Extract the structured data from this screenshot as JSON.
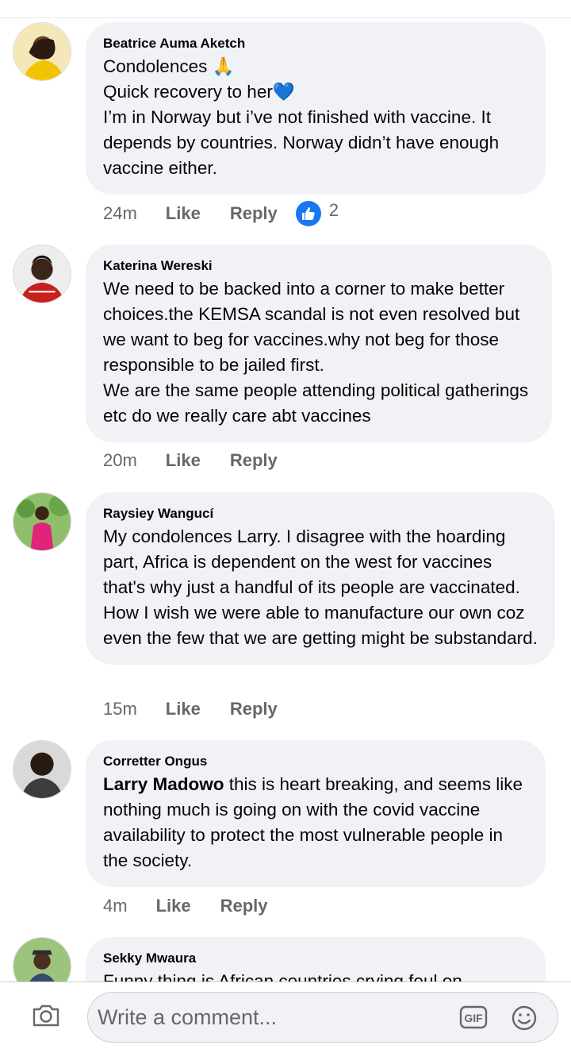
{
  "comments": [
    {
      "author": "Beatrice Auma Aketch",
      "text": "Condolences 🙏\nQuick recovery to her💙\nI’m in Norway but i’ve not finished with vaccine. It depends by countries. Norway didn’t have enough vaccine either.",
      "time": "24m",
      "like_label": "Like",
      "reply_label": "Reply",
      "reaction_count": "2"
    },
    {
      "author": "Katerina Wereski",
      "text": "We need to be backed into a corner to make better choices.the KEMSA scandal is not even resolved but we want to beg for vaccines.why not beg for those responsible to be jailed first.\nWe are the same people attending political gatherings etc do we really care abt vaccines",
      "time": "20m",
      "like_label": "Like",
      "reply_label": "Reply"
    },
    {
      "author": "Raysiey Wangucí",
      "text": "My condolences Larry. I disagree with the hoarding part, Africa is dependent on the west for vaccines that's why just a handful of its people are vaccinated. How I wish we were able to manufacture our own coz even the few that we are getting might be substandard.",
      "time": "15m",
      "like_label": "Like",
      "reply_label": "Reply"
    },
    {
      "author": "Corretter Ongus",
      "mention": "Larry Madowo",
      "text": " this is heart breaking, and seems like nothing much is going on with the covid vaccine availability to protect the most vulnerable people in the society.",
      "time": "4m",
      "like_label": "Like",
      "reply_label": "Reply"
    },
    {
      "author": "Sekky Mwaura",
      "text": "Funny thing is African countries crying foul on"
    }
  ],
  "composer": {
    "placeholder": "Write a comment...",
    "camera_icon": "camera-icon",
    "gif_icon": "gif-icon",
    "emoji_icon": "smile-icon"
  },
  "colors": {
    "bubble": "#f0f2f5",
    "meta_text": "#65676b",
    "like_blue": "#1877f2"
  }
}
